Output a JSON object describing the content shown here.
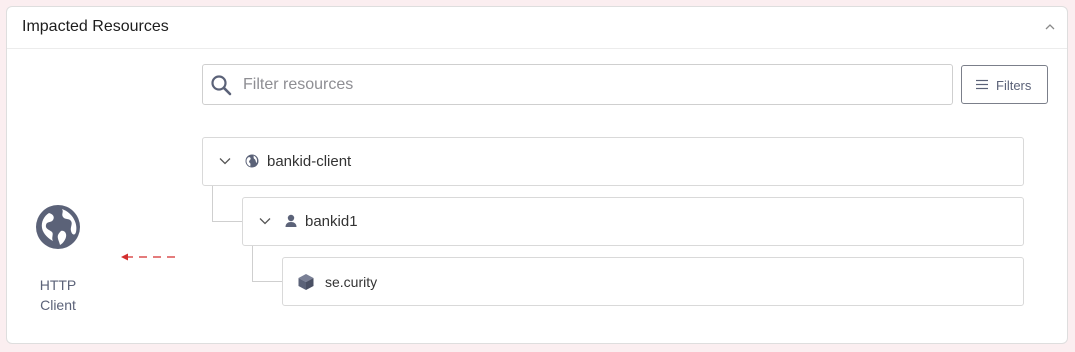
{
  "panel": {
    "title": "Impacted Resources",
    "collapse_icon": "chevron-up-icon"
  },
  "client": {
    "icon": "globe-icon",
    "label_line1": "HTTP",
    "label_line2": "Client",
    "arrow_color": "#d32f2f"
  },
  "search": {
    "placeholder": "Filter resources",
    "value": "",
    "icon": "search-icon"
  },
  "filters": {
    "label": "Filters",
    "icon": "sliders-icon"
  },
  "tree": [
    {
      "label": "bankid-client",
      "icon": "globe-icon",
      "expanded": true
    },
    {
      "label": "bankid1",
      "icon": "user-icon",
      "expanded": true
    },
    {
      "label": "se.curity",
      "icon": "cube-icon"
    }
  ],
  "colors": {
    "accent_gray": "#5b6278",
    "border": "#d9d9d9",
    "background": "#fbeef0"
  }
}
